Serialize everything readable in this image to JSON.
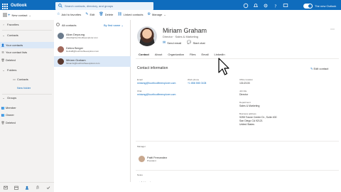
{
  "app": {
    "title": "Outlook",
    "new_outlook_label": "The new Outlook",
    "new_outlook_enabled": true
  },
  "search": {
    "placeholder": "Search contacts, directory, and groups"
  },
  "toolbar": {
    "new_contact": "New contact",
    "add_favorites": "Add to favorites",
    "edit": "Edit",
    "delete": "Delete",
    "linked_contacts": "Linked contacts",
    "manage": "Manage"
  },
  "sidebar": {
    "favorites": "Favorites",
    "contacts": "Contacts",
    "your_contacts": "Your contacts",
    "your_contact_lists": "Your contact lists",
    "deleted": "Deleted",
    "folders": "Folders",
    "folder_contacts": "Contacts",
    "new_folder": "New folder",
    "groups": "Groups",
    "member": "Member",
    "owner": "Owner",
    "groups_deleted": "Deleted"
  },
  "list": {
    "header": "All contacts",
    "sort_label": "By first name",
    "contacts": [
      {
        "name": "Allan Deyoung",
        "email": "AllanD@fourthcoffeeexplorer.com",
        "color": "#6b7b8c"
      },
      {
        "name": "Debra Berger",
        "email": "DebraB@fourthcoffeeexplorer.com",
        "color": "#a0675a"
      },
      {
        "name": "Miriam Graham",
        "email": "MiriamG@fourthcoffeeexplorer.com",
        "color": "#5a3a30"
      }
    ]
  },
  "contact": {
    "name": "Miriam Graham",
    "job": "Director  ·  Sales & Marketing",
    "send_email": "Send email",
    "start_chat": "Start chat",
    "tabs": [
      "Contact",
      "About",
      "Organization",
      "Files",
      "Email",
      "LinkedIn"
    ],
    "active_tab": "Contact",
    "info_title": "Contact information",
    "edit_contact": "Edit contact",
    "fields": {
      "email_label": "Email",
      "email_value": "miriamg@fourthcoffeeexplorer.com",
      "chat_label": "Chat",
      "chat_value": "miriamg@fourthcoffeeexplorer.com",
      "work_phone_label": "Work phone",
      "work_phone_value": "+1 858 555 0108",
      "office_label": "Office location",
      "office_value": "131/2103",
      "job_label": "Job title",
      "job_value": "Director",
      "department_label": "Department",
      "department_value": "Sales & Marketing",
      "address_label": "Business address",
      "address_line1": "9255 Towne Center Dr., Suite 400",
      "address_line2": "San Diego CA 92121",
      "address_line3": "United States"
    },
    "manager_label": "Manager",
    "manager_name": "Patti Fernandez",
    "manager_title": "President",
    "notes_label": "Notes",
    "add_notes": "Add notes"
  },
  "colors": {
    "accent": "#0f6cbd",
    "selected": "#dbe8f7",
    "nav_bg": "#f3f2f1"
  },
  "icons": [
    "waffle-icon",
    "search-icon",
    "hamburger-icon",
    "plus-icon",
    "star-icon",
    "pencil-icon",
    "trash-icon",
    "link-icon",
    "chevron-down-icon",
    "mail-icon",
    "chat-icon",
    "more-icon",
    "calendar-icon",
    "people-icon",
    "paperclip-icon",
    "todo-icon",
    "cursor-icon"
  ]
}
